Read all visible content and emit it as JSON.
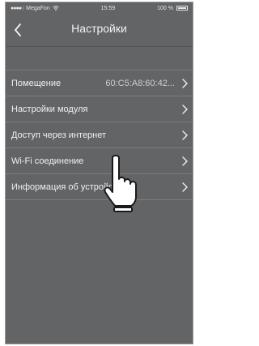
{
  "status_bar": {
    "carrier": "MegaFon",
    "time": "15:59",
    "battery": "100 %"
  },
  "nav": {
    "title": "Настройки"
  },
  "settings": {
    "items": [
      {
        "label": "Помещение",
        "value": "60:C5:A8:60:42..."
      },
      {
        "label": "Настройки модуля"
      },
      {
        "label": "Доступ через интернет"
      },
      {
        "label": "Wi-Fi соединение"
      },
      {
        "label": "Информация об устройстве"
      }
    ]
  },
  "colors": {
    "background": "#626466",
    "text": "#f0f0f0",
    "separator": "#7a7c7e"
  },
  "icons": [
    "chevron-left-icon",
    "chevron-right-icon",
    "wifi-icon",
    "battery-icon",
    "hand-pointer-icon"
  ]
}
